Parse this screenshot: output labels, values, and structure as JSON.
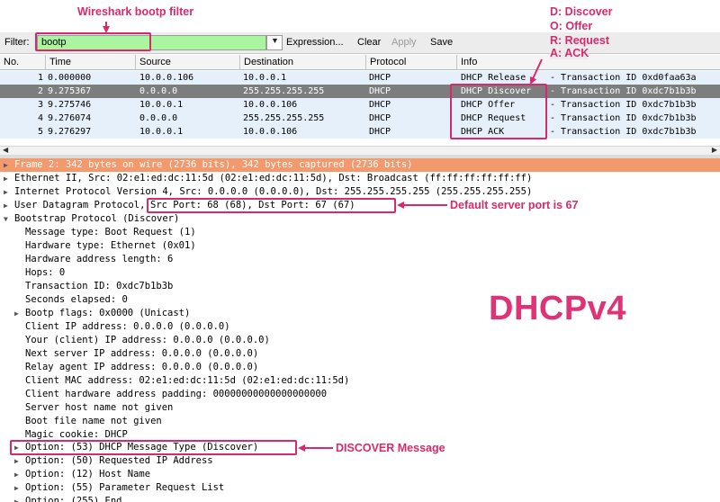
{
  "annotations": {
    "filter_note": "Wireshark bootp filter",
    "legend": [
      "D: Discover",
      "O: Offer",
      "R: Request",
      "A: ACK"
    ],
    "port_note": "Default server port is 67",
    "discover_note": "DISCOVER Message",
    "big_label": "DHCPv4",
    "accent_color": "#d8296c"
  },
  "toolbar": {
    "filter_label": "Filter:",
    "filter_value": "bootp",
    "expression_label": "Expression...",
    "clear_label": "Clear",
    "apply_label": "Apply",
    "save_label": "Save"
  },
  "packet_list": {
    "columns": [
      "No.",
      "Time",
      "Source",
      "Destination",
      "Protocol",
      "Info"
    ],
    "rows": [
      {
        "no": "1",
        "time": "0.000000",
        "source": "10.0.0.106",
        "destination": "10.0.0.1",
        "protocol": "DHCP",
        "msg": "DHCP Release",
        "txn": "- Transaction ID 0xd0faa63a"
      },
      {
        "no": "2",
        "time": "9.275367",
        "source": "0.0.0.0",
        "destination": "255.255.255.255",
        "protocol": "DHCP",
        "msg": "DHCP Discover",
        "txn": "- Transaction ID 0xdc7b1b3b"
      },
      {
        "no": "3",
        "time": "9.275746",
        "source": "10.0.0.1",
        "destination": "10.0.0.106",
        "protocol": "DHCP",
        "msg": "DHCP Offer",
        "txn": "- Transaction ID 0xdc7b1b3b"
      },
      {
        "no": "4",
        "time": "9.276074",
        "source": "0.0.0.0",
        "destination": "255.255.255.255",
        "protocol": "DHCP",
        "msg": "DHCP Request",
        "txn": "- Transaction ID 0xdc7b1b3b"
      },
      {
        "no": "5",
        "time": "9.276297",
        "source": "10.0.0.1",
        "destination": "10.0.0.106",
        "protocol": "DHCP",
        "msg": "DHCP ACK",
        "txn": "- Transaction ID 0xdc7b1b3b"
      }
    ],
    "selected_row": 2
  },
  "details": {
    "frame": "Frame 2: 342 bytes on wire (2736 bits), 342 bytes captured (2736 bits)",
    "ethernet": "Ethernet II, Src: 02:e1:ed:dc:11:5d (02:e1:ed:dc:11:5d), Dst: Broadcast (ff:ff:ff:ff:ff:ff)",
    "ip": "Internet Protocol Version 4, Src: 0.0.0.0 (0.0.0.0), Dst: 255.255.255.255 (255.255.255.255)",
    "udp_prefix": "User Datagram Protocol,",
    "udp_ports": "Src Port: 68 (68), Dst Port: 67 (67)",
    "bootp": "Bootstrap Protocol (Discover)",
    "bootp_fields": [
      "Message type: Boot Request (1)",
      "Hardware type: Ethernet (0x01)",
      "Hardware address length: 6",
      "Hops: 0",
      "Transaction ID: 0xdc7b1b3b",
      "Seconds elapsed: 0",
      "Bootp flags: 0x0000 (Unicast)",
      "Client IP address: 0.0.0.0 (0.0.0.0)",
      "Your (client) IP address: 0.0.0.0 (0.0.0.0)",
      "Next server IP address: 0.0.0.0 (0.0.0.0)",
      "Relay agent IP address: 0.0.0.0 (0.0.0.0)",
      "Client MAC address: 02:e1:ed:dc:11:5d (02:e1:ed:dc:11:5d)",
      "Client hardware address padding: 00000000000000000000",
      "Server host name not given",
      "Boot file name not given",
      "Magic cookie: DHCP",
      "Option: (53) DHCP Message Type (Discover)",
      "Option: (50) Requested IP Address",
      "Option: (12) Host Name",
      "Option: (55) Parameter Request List",
      "Option: (255) End"
    ]
  }
}
